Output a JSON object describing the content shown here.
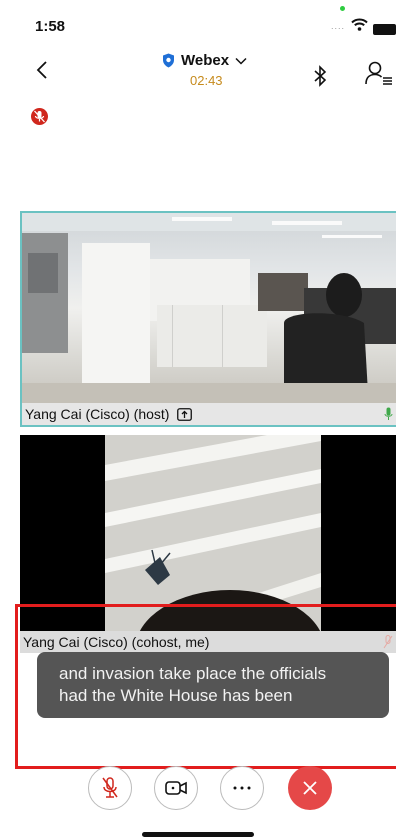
{
  "status": {
    "time": "1:58",
    "signal_dots": "....",
    "accent_green": "#2ecc40"
  },
  "header": {
    "title": "Webex",
    "timer": "02:43",
    "timer_color": "#c68b1d"
  },
  "icons": {
    "back": "chevron-left-icon",
    "shield": "shield-icon",
    "dropdown": "chevron-down-icon",
    "bluetooth": "bluetooth-icon",
    "participants": "participants-icon",
    "alert": "muted-alert-icon",
    "mic_off": "mic-off-icon",
    "camera": "camera-icon",
    "more": "more-icon",
    "leave": "close-icon"
  },
  "participants": [
    {
      "name": "Yang Cai (Cisco) (host)",
      "role_icon": "share-up-icon",
      "mic_status": "unmuted",
      "border_color": "#6bc2c2"
    },
    {
      "name": "Yang Cai (Cisco) (cohost, me)",
      "mic_status": "muted"
    }
  ],
  "caption": {
    "line1": "and invasion take place the officials",
    "line2": "had the White House has been"
  },
  "controls": {
    "leave_color": "#e54848",
    "mute_color": "#d0271d"
  }
}
